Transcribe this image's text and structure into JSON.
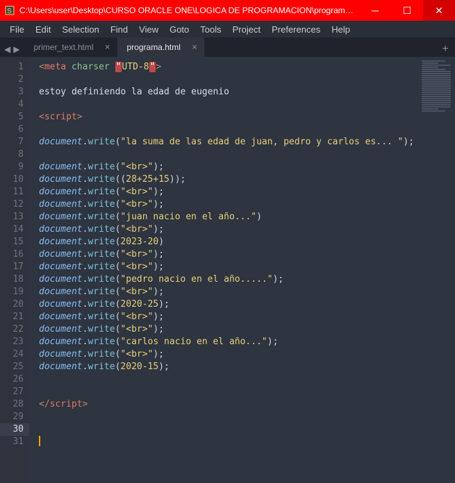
{
  "titlebar": {
    "title": "C:\\Users\\user\\Desktop\\CURSO ORACLE ONE\\LOGICA DE PROGRAMACION\\programa.html - S…"
  },
  "menubar": [
    "File",
    "Edit",
    "Selection",
    "Find",
    "View",
    "Goto",
    "Tools",
    "Project",
    "Preferences",
    "Help"
  ],
  "tabs": [
    {
      "label": "primer_text.html",
      "active": false
    },
    {
      "label": "programa.html",
      "active": true
    }
  ],
  "line_numbers": [
    "1",
    "2",
    "3",
    "4",
    "5",
    "6",
    "7",
    "8",
    "9",
    "10",
    "11",
    "12",
    "13",
    "14",
    "15",
    "16",
    "17",
    "18",
    "19",
    "20",
    "21",
    "22",
    "23",
    "24",
    "25",
    "26",
    "27",
    "28",
    "29",
    "30",
    "31"
  ],
  "active_gutter_line": "30",
  "code": {
    "l1": {
      "a": "<",
      "b": "meta",
      "sp": " ",
      "c": "charser",
      "sp2": " ",
      "e1": "\"",
      "d": "UTD-8",
      "e2": "\"",
      "f": ">"
    },
    "l3": "estoy definiendo la edad de eugenio",
    "l5": {
      "a": "<",
      "b": "script",
      "c": ">"
    },
    "l7": {
      "obj": "document",
      "dot": ".",
      "fn": "write",
      "op": "(",
      "str": "\"la suma de las edad de juan, pedro y carlos es... \"",
      "cl": ");"
    },
    "l8": {
      "obj": "document",
      "dot": ".",
      "fn": "write",
      "op": "(",
      "str": "\"<br>\"",
      "cl": ");"
    },
    "l9": {
      "obj": "document",
      "dot": ".",
      "fn": "write",
      "op": "((",
      "nums": "28+25+15",
      "cl": "));"
    },
    "l10": {
      "obj": "document",
      "dot": ".",
      "fn": "write",
      "op": "(",
      "str": "\"<br>\"",
      "cl": ");"
    },
    "l11": {
      "obj": "document",
      "dot": ".",
      "fn": "write",
      "op": "(",
      "str": "\"<br>\"",
      "cl": ");"
    },
    "l12": {
      "obj": "document",
      "dot": ".",
      "fn": "write",
      "op": "(",
      "str": "\"juan nacio en el año...\"",
      "cl": ")"
    },
    "l13": {
      "obj": "document",
      "dot": ".",
      "fn": "write",
      "op": "(",
      "str": "\"<br>\"",
      "cl": ");"
    },
    "l14": {
      "obj": "document",
      "dot": ".",
      "fn": "write",
      "op": "(",
      "nums": "2023-20",
      "cl": ")"
    },
    "l15": {
      "obj": "document",
      "dot": ".",
      "fn": "write",
      "op": "(",
      "str": "\"<br>\"",
      "cl": ");"
    },
    "l16": {
      "obj": "document",
      "dot": ".",
      "fn": "write",
      "op": "(",
      "str": "\"<br>\"",
      "cl": ");"
    },
    "l17": {
      "obj": "document",
      "dot": ".",
      "fn": "write",
      "op": "(",
      "str": "\"pedro nacio en el año.....\"",
      "cl": ");"
    },
    "l18": {
      "obj": "document",
      "dot": ".",
      "fn": "write",
      "op": "(",
      "str": "\"<br>\"",
      "cl": ");"
    },
    "l19": {
      "obj": "document",
      "dot": ".",
      "fn": "write",
      "op": "(",
      "nums": "2020-25",
      "cl": ");"
    },
    "l20": {
      "obj": "document",
      "dot": ".",
      "fn": "write",
      "op": "(",
      "str": "\"<br>\"",
      "cl": ");"
    },
    "l21": {
      "obj": "document",
      "dot": ".",
      "fn": "write",
      "op": "(",
      "str": "\"<br>\"",
      "cl": ");"
    },
    "l22": {
      "obj": "document",
      "dot": ".",
      "fn": "write",
      "op": "(",
      "str": "\"carlos nacio en el año...\"",
      "cl": ");"
    },
    "l23": {
      "obj": "document",
      "dot": ".",
      "fn": "write",
      "op": "(",
      "str": "\"<br>\"",
      "cl": ");"
    },
    "l24": {
      "obj": "document",
      "dot": ".",
      "fn": "write",
      "op": "(",
      "nums": "2020-15",
      "cl": ");"
    },
    "l27": {
      "a": "</",
      "b": "script",
      "c": ">"
    }
  }
}
